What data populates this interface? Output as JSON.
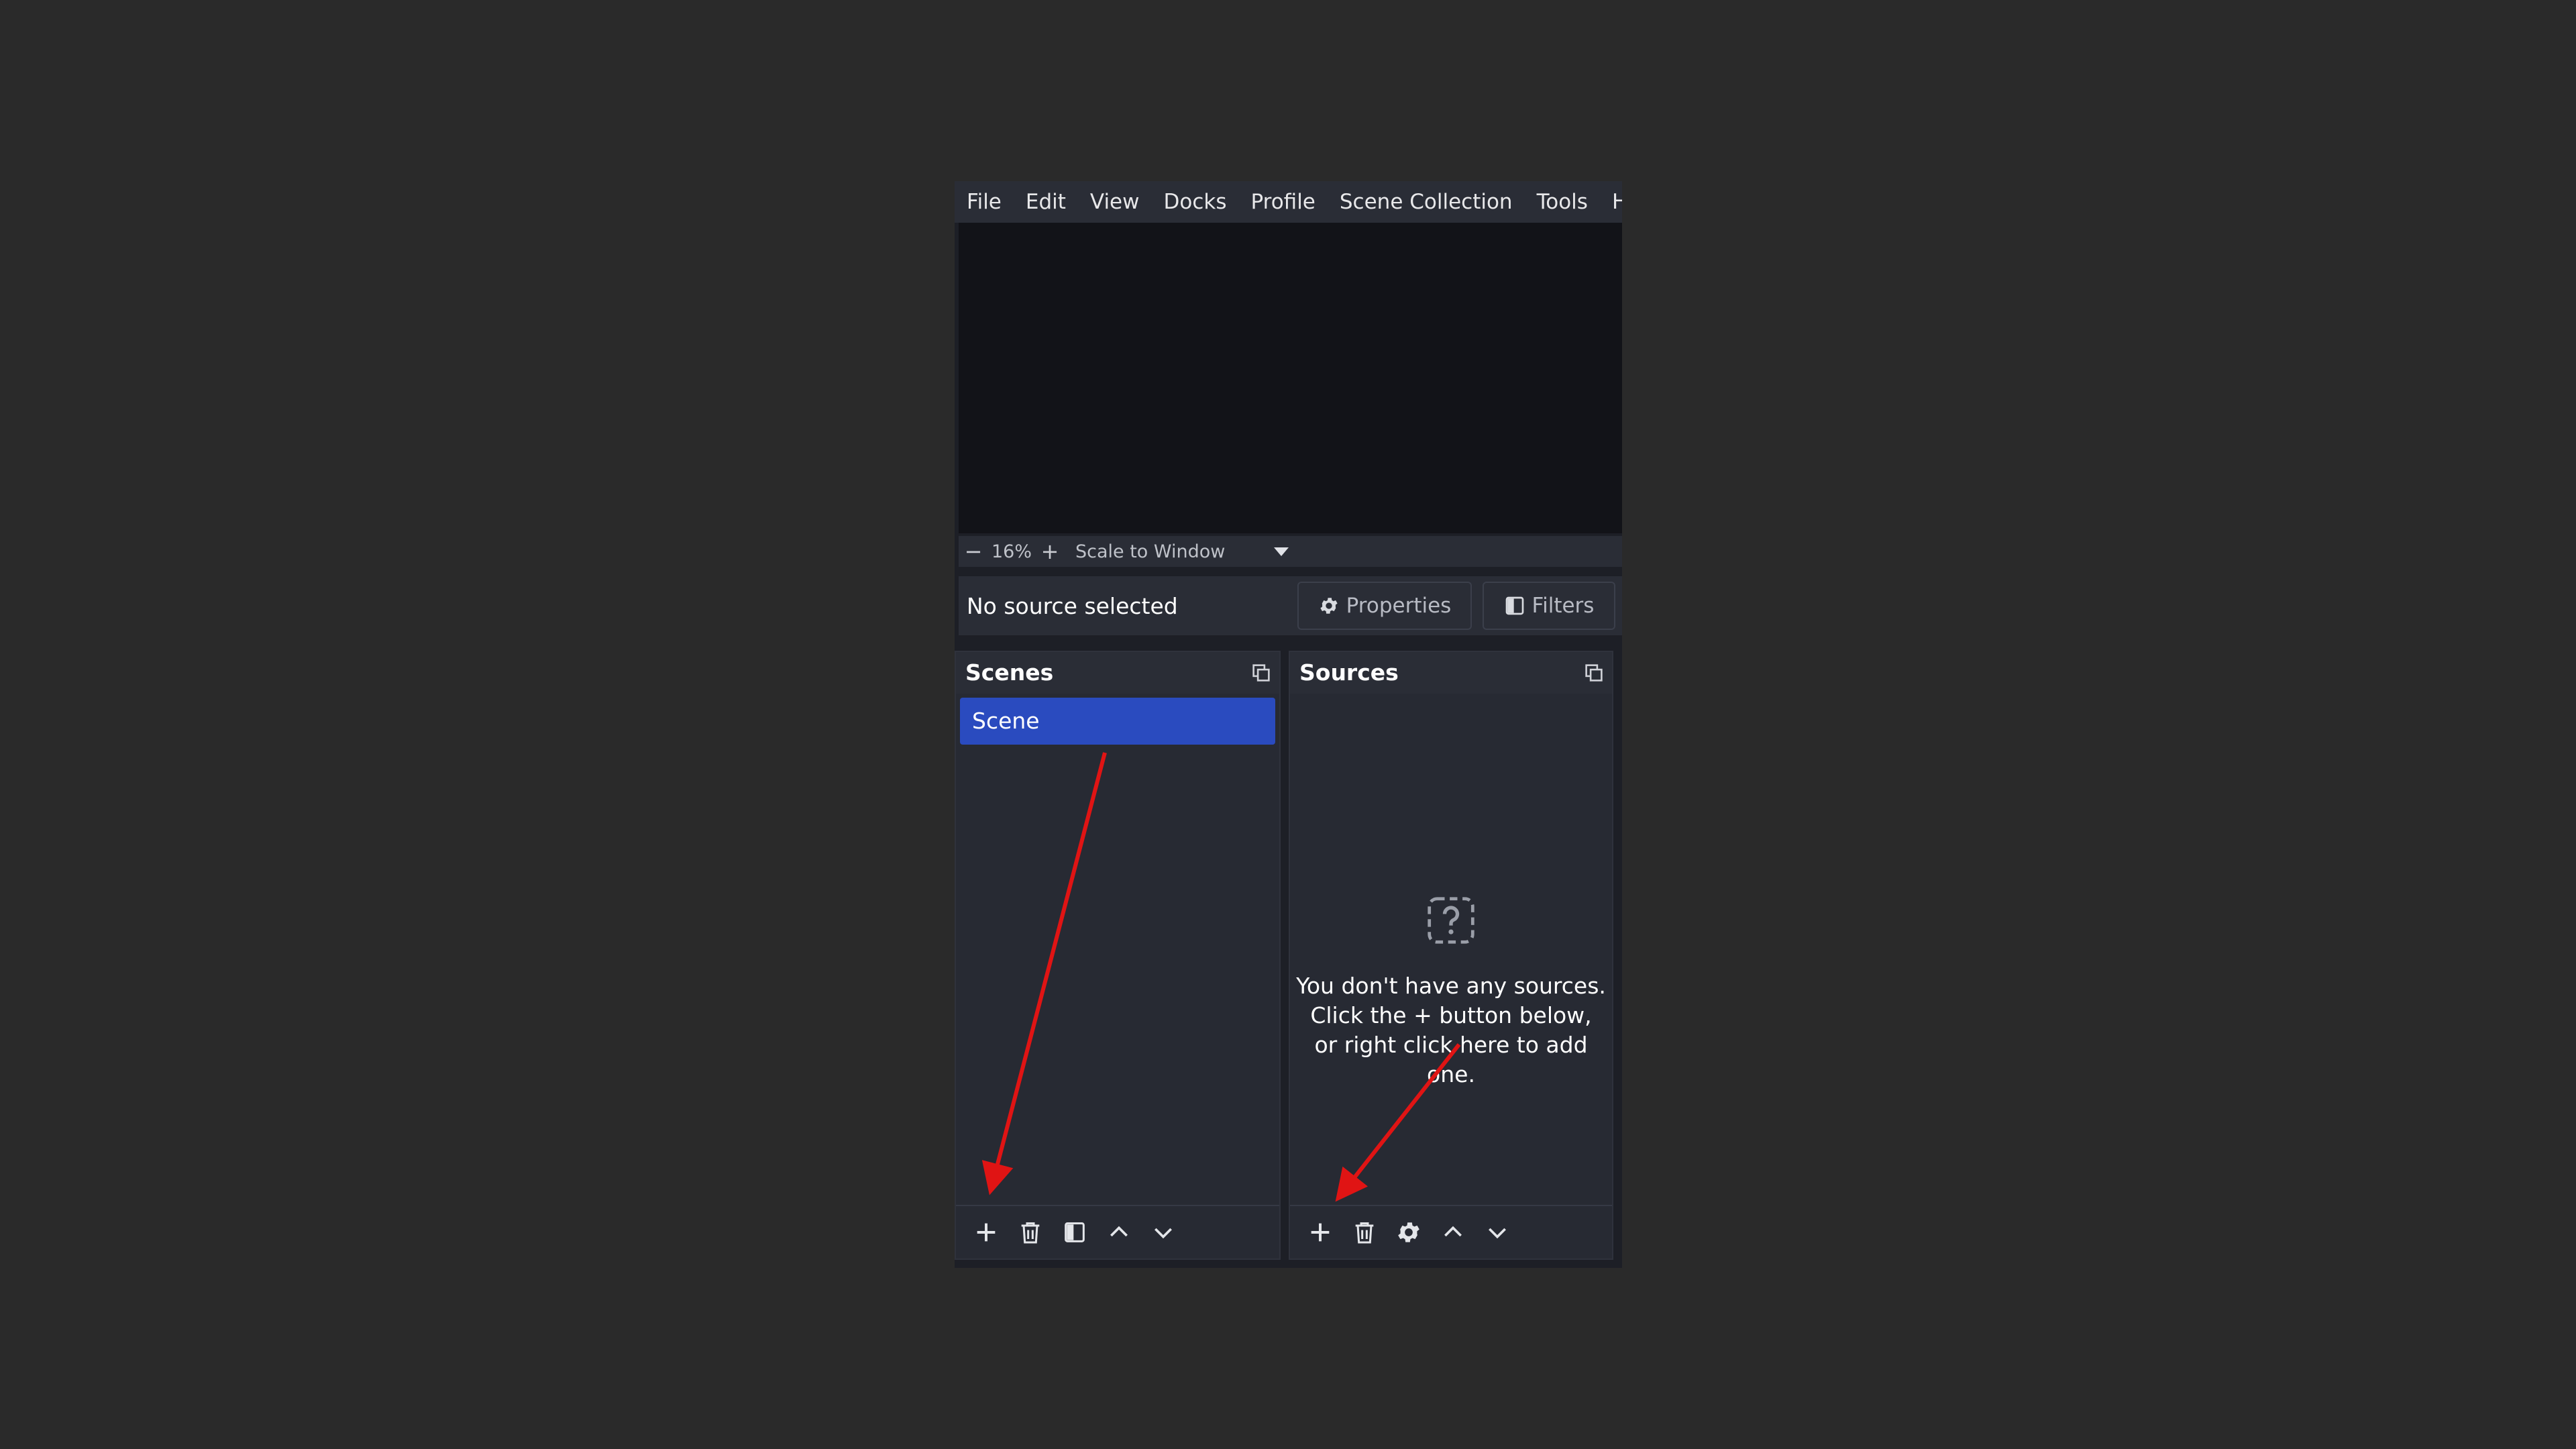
{
  "menu": {
    "items": [
      "File",
      "Edit",
      "View",
      "Docks",
      "Profile",
      "Scene Collection",
      "Tools",
      "Hel"
    ]
  },
  "zoom": {
    "minus": "−",
    "value": "16%",
    "plus": "+",
    "scale_mode": "Scale to Window"
  },
  "context": {
    "status": "No source selected",
    "properties_label": "Properties",
    "filters_label": "Filters"
  },
  "scenes_dock": {
    "title": "Scenes",
    "items": [
      "Scene"
    ],
    "toolbar_icons": [
      "add-icon",
      "trash-icon",
      "filters-icon",
      "move-up-icon",
      "move-down-icon"
    ]
  },
  "sources_dock": {
    "title": "Sources",
    "empty_message": "You don't have any sources.\nClick the + button below,\nor right click here to add one.",
    "toolbar_icons": [
      "add-icon",
      "trash-icon",
      "gear-icon",
      "move-up-icon",
      "move-down-icon"
    ]
  },
  "colors": {
    "background": "#2a2a2a",
    "selected_scene": "#2a4bbf",
    "annotation_arrow": "#e01414"
  }
}
